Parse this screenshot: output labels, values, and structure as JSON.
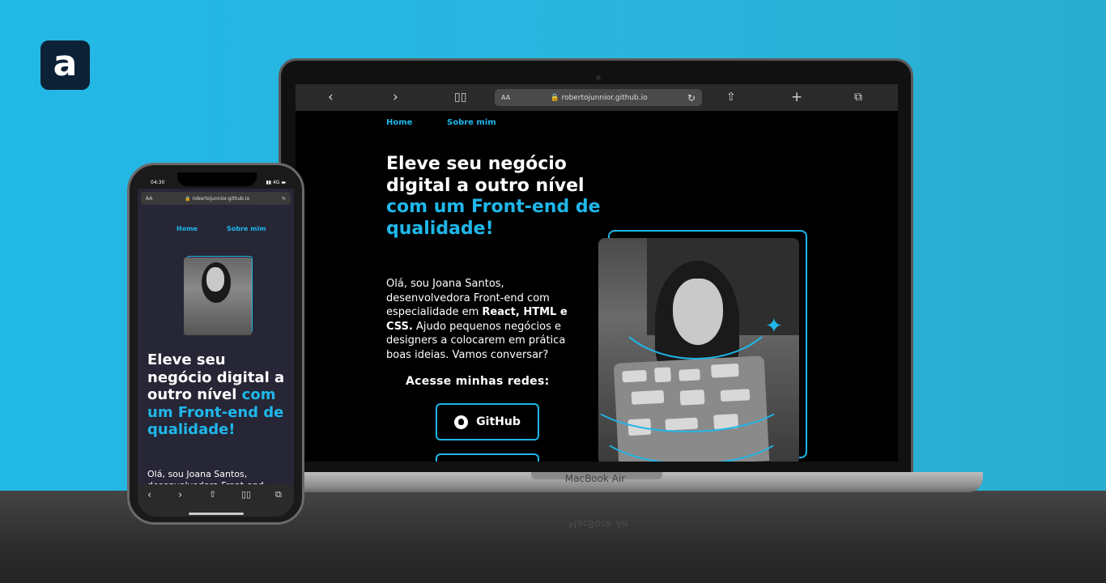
{
  "brand": {
    "logo_letter": "a"
  },
  "laptop": {
    "device_label": "MacBook Air",
    "browser": {
      "text_size_label": "AA",
      "url": "robertojunnior.github.io",
      "icons": [
        "chevron-left-icon",
        "chevron-right-icon",
        "book-icon",
        "reload-icon",
        "share-icon",
        "plus-icon",
        "tabs-icon"
      ]
    },
    "site": {
      "nav": [
        "Home",
        "Sobre mim"
      ],
      "title_main": "Eleve seu negócio digital a outro nível ",
      "title_accent": "com um Front-end de qualidade!",
      "desc_part1": "Olá, sou Joana Santos, desenvolvedora Front-end com especialidade em ",
      "desc_bold": "React, HTML e CSS.",
      "desc_part2": " Ajudo pequenos negócios e designers a colocarem em prática boas ideias. Vamos conversar?",
      "socials_heading": "Acesse minhas redes:",
      "github_label": "GitHub"
    }
  },
  "phone": {
    "time": "04:30",
    "signal": "4G",
    "text_size_label": "AA",
    "url": "robertojunnior.github.io",
    "nav": [
      "Home",
      "Sobre mim"
    ],
    "title_main": "Eleve seu negócio digital a outro nível ",
    "title_accent": "com um Front-end de qualidade!",
    "desc": "Olá, sou Joana Santos, desenvolvedora Front-end"
  },
  "colors": {
    "accent": "#1fb7ea",
    "background": "#22b8e6",
    "site_bg": "#000000",
    "phone_site_bg": "#262636"
  }
}
